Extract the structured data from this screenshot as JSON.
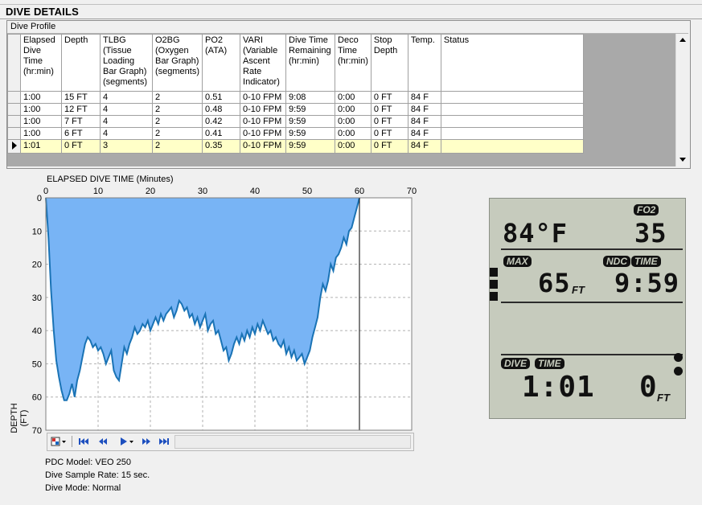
{
  "section_title": "DIVE DETAILS",
  "group_title": "Dive Profile",
  "table": {
    "headers": [
      "Elapsed Dive Time (hr:min)",
      "Depth",
      "TLBG (Tissue Loading Bar Graph) (segments)",
      "O2BG (Oxygen Bar Graph) (segments)",
      "PO2 (ATA)",
      "VARI (Variable Ascent Rate Indicator)",
      "Dive Time Remaining (hr:min)",
      "Deco Time (hr:min)",
      "Stop Depth",
      "Temp.",
      "Status"
    ],
    "rows": [
      [
        "1:00",
        "15 FT",
        "4",
        "2",
        "0.51",
        "0-10 FPM",
        "9:08",
        "0:00",
        "0 FT",
        "84 F",
        ""
      ],
      [
        "1:00",
        "12 FT",
        "4",
        "2",
        "0.48",
        "0-10 FPM",
        "9:59",
        "0:00",
        "0 FT",
        "84 F",
        ""
      ],
      [
        "1:00",
        "7 FT",
        "4",
        "2",
        "0.42",
        "0-10 FPM",
        "9:59",
        "0:00",
        "0 FT",
        "84 F",
        ""
      ],
      [
        "1:00",
        "6 FT",
        "4",
        "2",
        "0.41",
        "0-10 FPM",
        "9:59",
        "0:00",
        "0 FT",
        "84 F",
        ""
      ],
      [
        "1:01",
        "0 FT",
        "3",
        "2",
        "0.35",
        "0-10 FPM",
        "9:59",
        "0:00",
        "0 FT",
        "84 F",
        ""
      ]
    ],
    "selected_row": 4
  },
  "chart_data": {
    "type": "area",
    "title": "ELAPSED DIVE TIME (Minutes)",
    "xlabel": "ELAPSED DIVE TIME (Minutes)",
    "ylabel": "DEPTH (FT)",
    "xlim": [
      0,
      70
    ],
    "ylim": [
      0,
      70
    ],
    "y_inverted": true,
    "x_ticks": [
      0,
      10,
      20,
      30,
      40,
      50,
      60,
      70
    ],
    "y_ticks": [
      0,
      10,
      20,
      30,
      40,
      50,
      60,
      70
    ],
    "grid": true,
    "fill_color": "#78b4f5",
    "line_color": "#1a73b5",
    "cursor_x": 60,
    "x": [
      0,
      0.5,
      1,
      1.5,
      2,
      2.5,
      3,
      3.5,
      4,
      4.5,
      5,
      5.5,
      6,
      6.5,
      7,
      7.5,
      8,
      8.5,
      9,
      9.5,
      10,
      10.5,
      11,
      11.5,
      12,
      12.5,
      13,
      13.5,
      14,
      14.5,
      15,
      15.5,
      16,
      16.5,
      17,
      17.5,
      18,
      18.5,
      19,
      19.5,
      20,
      20.5,
      21,
      21.5,
      22,
      22.5,
      23,
      23.5,
      24,
      24.5,
      25,
      25.5,
      26,
      26.5,
      27,
      27.5,
      28,
      28.5,
      29,
      29.5,
      30,
      30.5,
      31,
      31.5,
      32,
      32.5,
      33,
      33.5,
      34,
      34.5,
      35,
      35.5,
      36,
      36.5,
      37,
      37.5,
      38,
      38.5,
      39,
      39.5,
      40,
      40.5,
      41,
      41.5,
      42,
      42.5,
      43,
      43.5,
      44,
      44.5,
      45,
      45.5,
      46,
      46.5,
      47,
      47.5,
      48,
      48.5,
      49,
      49.5,
      50,
      50.5,
      51,
      51.5,
      52,
      52.5,
      53,
      53.5,
      54,
      54.5,
      55,
      55.5,
      56,
      56.5,
      57,
      57.5,
      58,
      58.5,
      59,
      59.5,
      60
    ],
    "depth": [
      0,
      12,
      28,
      40,
      49,
      54,
      58,
      61,
      61,
      59,
      56,
      60,
      55,
      52,
      48,
      44,
      42,
      43,
      45,
      44,
      46,
      45,
      47,
      50,
      48,
      46,
      52,
      54,
      55,
      50,
      45,
      47,
      44,
      42,
      39,
      41,
      40,
      38,
      39,
      37,
      40,
      38,
      36,
      38,
      35,
      37,
      35,
      34,
      33,
      36,
      34,
      31,
      32,
      34,
      33,
      36,
      35,
      38,
      36,
      39,
      37,
      35,
      40,
      38,
      37,
      41,
      40,
      43,
      46,
      45,
      49,
      47,
      44,
      42,
      44,
      41,
      43,
      40,
      42,
      39,
      41,
      38,
      40,
      37,
      39,
      41,
      40,
      43,
      42,
      44,
      45,
      43,
      47,
      45,
      48,
      46,
      49,
      48,
      47,
      50,
      48,
      46,
      42,
      39,
      36,
      30,
      26,
      28,
      25,
      20,
      22,
      18,
      17,
      15,
      12,
      14,
      10,
      9,
      6,
      3,
      0
    ]
  },
  "toolbar": {
    "buttons": [
      "color-picker",
      "first",
      "previous",
      "play",
      "next",
      "last"
    ]
  },
  "info": {
    "model": "PDC Model: VEO 250",
    "sample_rate": "Dive Sample Rate: 15 sec.",
    "mode": "Dive Mode: Normal"
  },
  "lcd": {
    "temp": "84°F",
    "fo2_label": "FO2",
    "fo2_value": "35",
    "max_label": "MAX",
    "max_value": "65",
    "max_unit": "FT",
    "ndc_label": "NDC",
    "time_label": "TIME",
    "ndc_value": "9:59",
    "dive_label": "DIVE",
    "dive_time_label": "TIME",
    "dive_time_value": "1:01",
    "depth_value": "0",
    "depth_unit": "FT"
  }
}
